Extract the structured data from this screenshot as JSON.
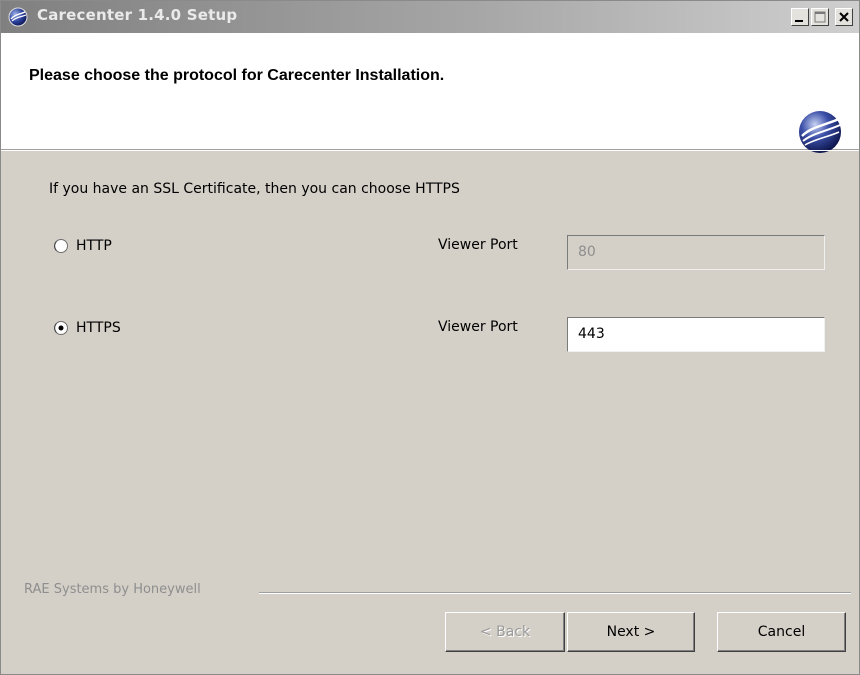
{
  "window": {
    "title": "Carecenter 1.4.0 Setup",
    "controls": {
      "minimize": "minimize-icon",
      "maximize": "maximize-icon",
      "close": "close-icon"
    }
  },
  "header": {
    "title": "Please choose the protocol for Carecenter Installation."
  },
  "content": {
    "info": "If you have an SSL Certificate, then you can choose HTTPS",
    "protocols": [
      {
        "label": "HTTP",
        "selected": false,
        "port_label": "Viewer Port",
        "port_value": "80",
        "port_enabled": false
      },
      {
        "label": "HTTPS",
        "selected": true,
        "port_label": "Viewer Port",
        "port_value": "443",
        "port_enabled": true
      }
    ]
  },
  "footer": {
    "brand": "RAE Systems by Honeywell",
    "back_label": "< Back",
    "next_label": "Next >",
    "cancel_label": "Cancel"
  },
  "colors": {
    "titlebar_start": "#808080",
    "titlebar_end": "#cfcfcf",
    "dialog_bg": "#d4d0c8",
    "header_bg": "#ffffff",
    "disabled_text": "#8e8e8e"
  }
}
